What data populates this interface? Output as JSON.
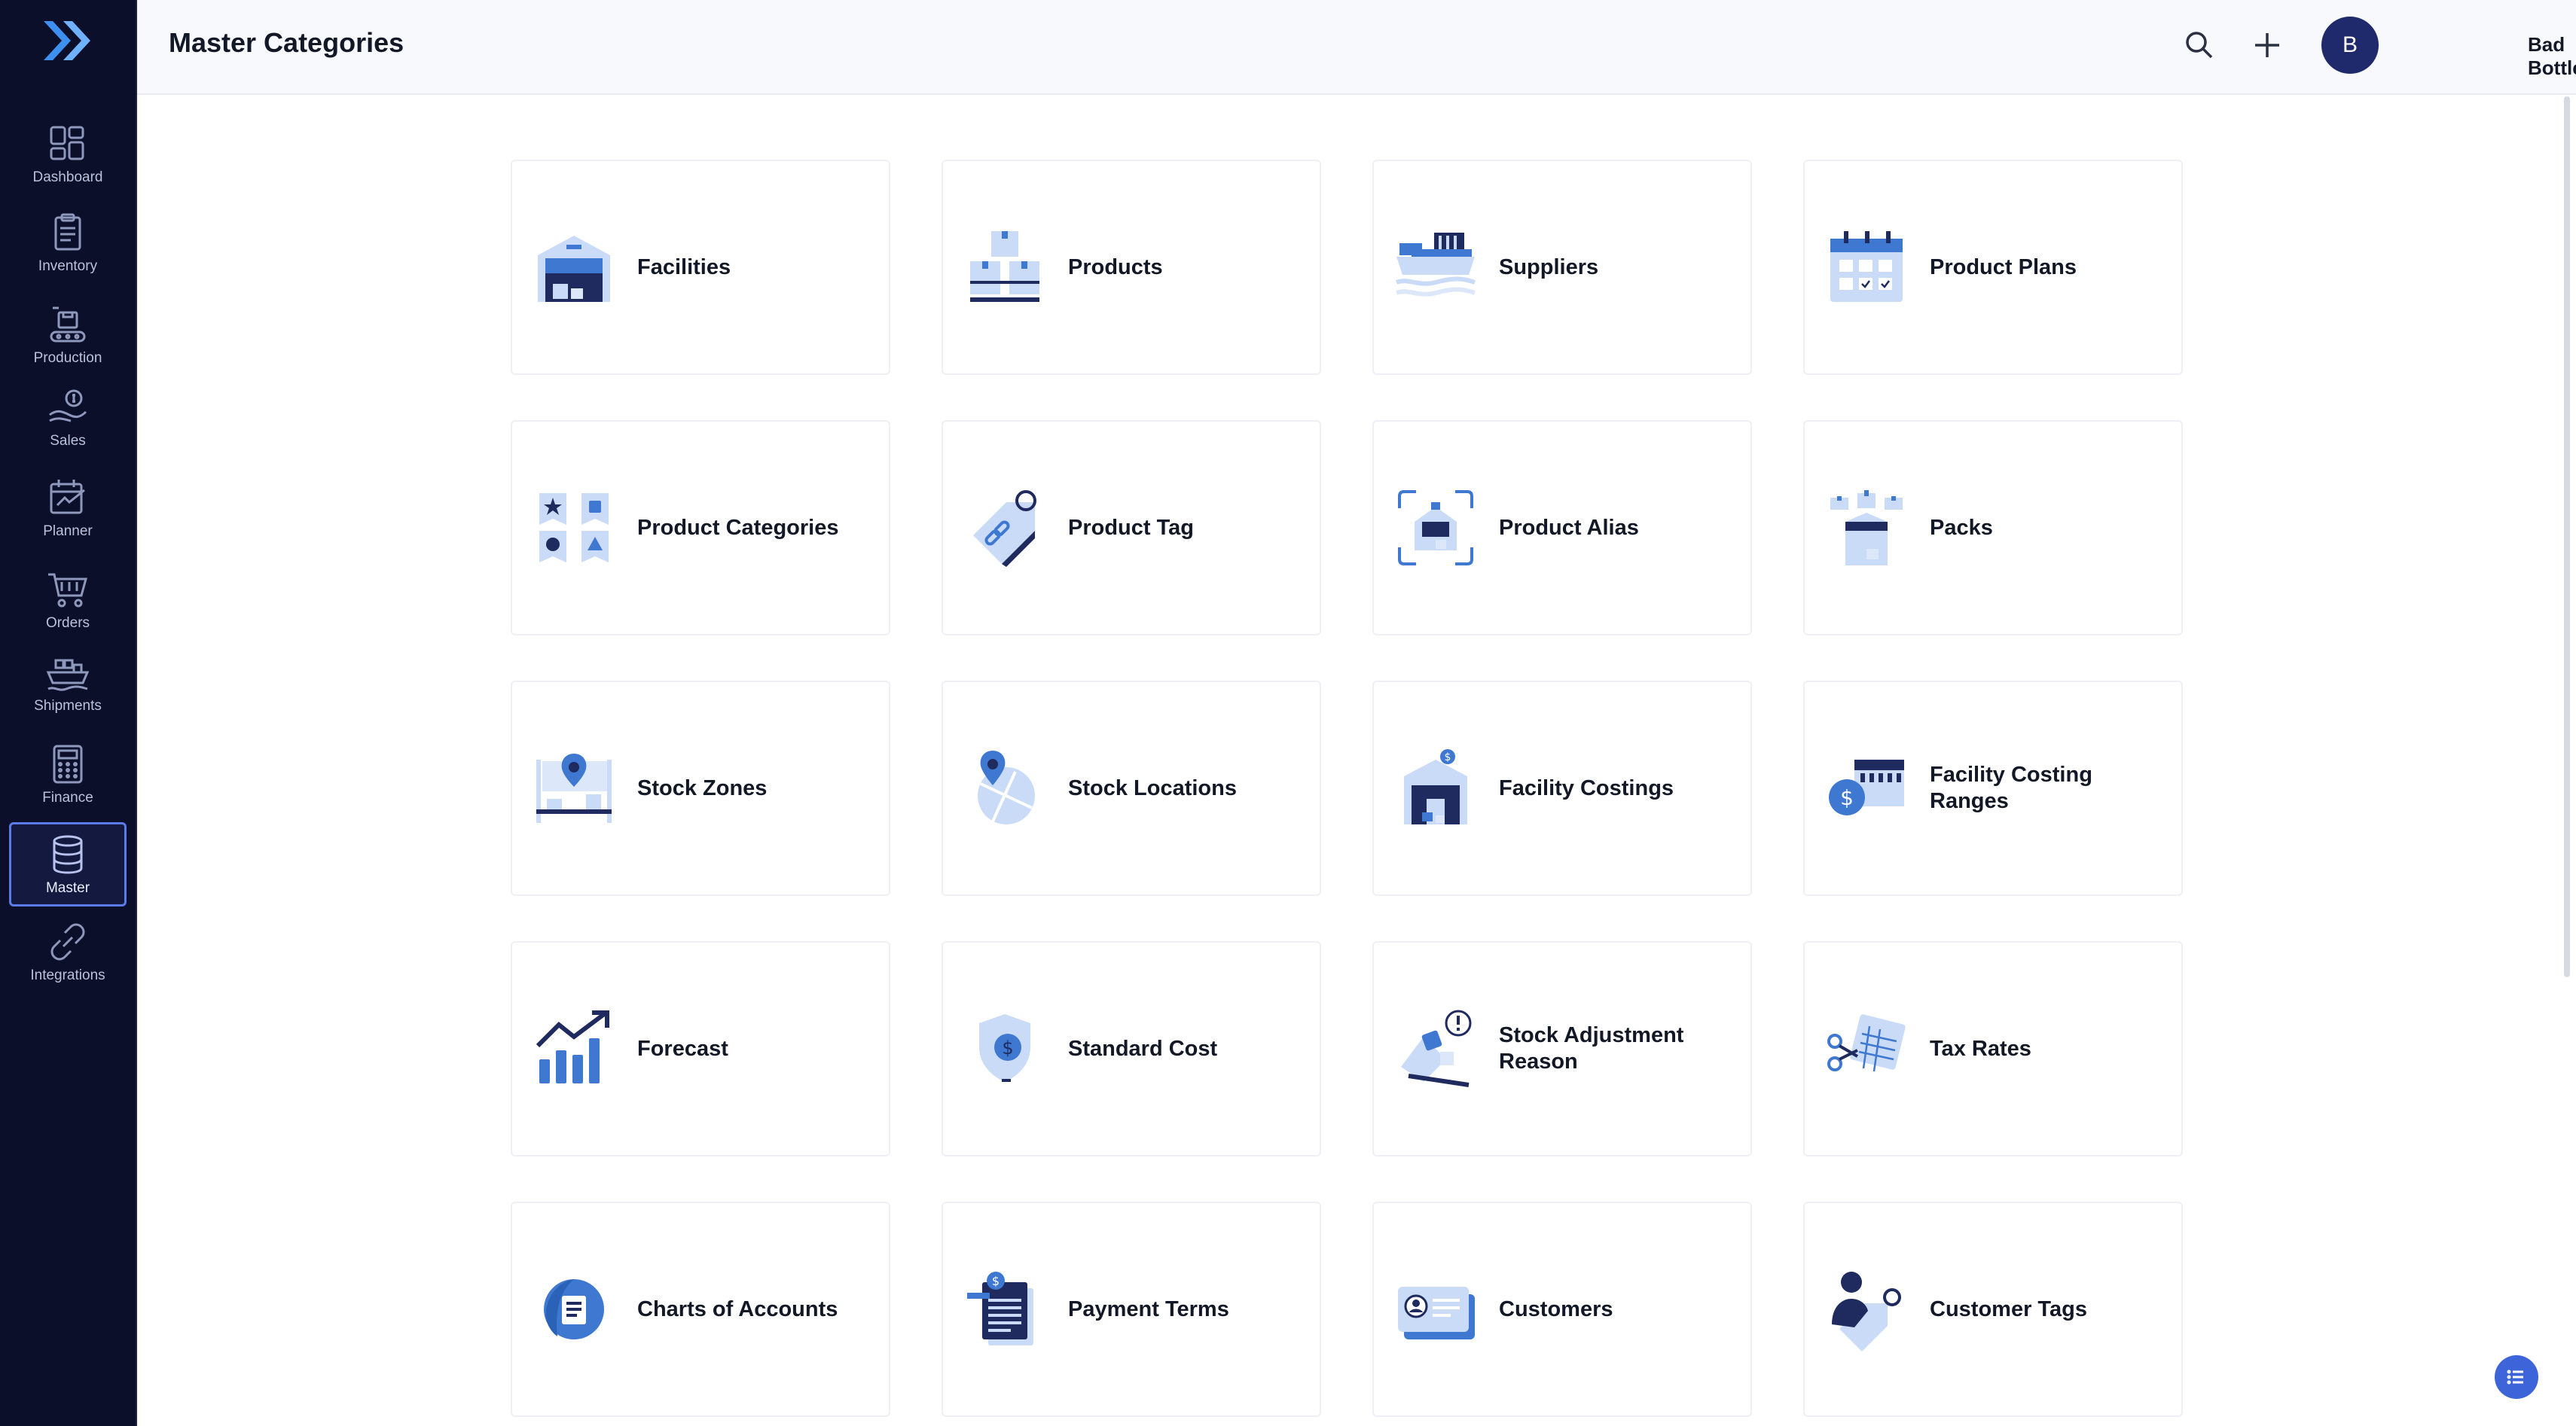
{
  "header": {
    "title": "Master Categories",
    "user_initial": "B",
    "user_name": "Bad Bottles"
  },
  "sidebar": {
    "items": [
      {
        "label": "Dashboard"
      },
      {
        "label": "Inventory"
      },
      {
        "label": "Production"
      },
      {
        "label": "Sales"
      },
      {
        "label": "Planner"
      },
      {
        "label": "Orders"
      },
      {
        "label": "Shipments"
      },
      {
        "label": "Finance"
      },
      {
        "label": "Master",
        "active": true
      },
      {
        "label": "Integrations"
      }
    ]
  },
  "cards": [
    {
      "label": "Facilities",
      "icon": "facilities-icon"
    },
    {
      "label": "Products",
      "icon": "products-icon"
    },
    {
      "label": "Suppliers",
      "icon": "suppliers-icon"
    },
    {
      "label": "Product Plans",
      "icon": "product-plans-icon"
    },
    {
      "label": "Product Categories",
      "icon": "product-categories-icon"
    },
    {
      "label": "Product Tag",
      "icon": "product-tag-icon"
    },
    {
      "label": "Product Alias",
      "icon": "product-alias-icon"
    },
    {
      "label": "Packs",
      "icon": "packs-icon"
    },
    {
      "label": "Stock Zones",
      "icon": "stock-zones-icon"
    },
    {
      "label": "Stock Locations",
      "icon": "stock-locations-icon"
    },
    {
      "label": "Facility Costings",
      "icon": "facility-costings-icon"
    },
    {
      "label": "Facility Costing Ranges",
      "icon": "facility-costing-ranges-icon"
    },
    {
      "label": "Forecast",
      "icon": "forecast-icon"
    },
    {
      "label": "Standard Cost",
      "icon": "standard-cost-icon"
    },
    {
      "label": "Stock Adjustment Reason",
      "icon": "stock-adjustment-reason-icon"
    },
    {
      "label": "Tax Rates",
      "icon": "tax-rates-icon"
    },
    {
      "label": "Charts of Accounts",
      "icon": "charts-of-accounts-icon"
    },
    {
      "label": "Payment Terms",
      "icon": "payment-terms-icon"
    },
    {
      "label": "Customers",
      "icon": "customers-icon"
    },
    {
      "label": "Customer Tags",
      "icon": "customer-tags-icon"
    }
  ],
  "colors": {
    "sidebar": "#0b0f2a",
    "accent": "#3d64d8",
    "icon_dark": "#1f2b5e",
    "icon_mid": "#3e78d1",
    "icon_light": "#c9dbf6"
  }
}
